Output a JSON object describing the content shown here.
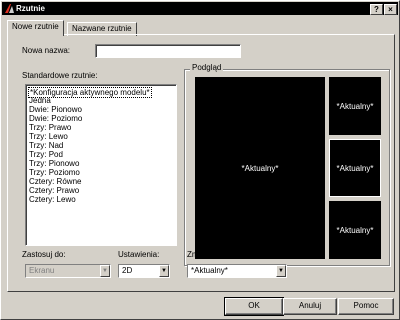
{
  "window": {
    "title": "Rzutnie",
    "help_label": "?",
    "close_label": "×"
  },
  "tabs": [
    {
      "label": "Nowe rzutnie",
      "active": true
    },
    {
      "label": "Nazwane rzutnie",
      "active": false
    }
  ],
  "new_name": {
    "label": "Nowa nazwa:",
    "value": ""
  },
  "standard_viewports": {
    "label": "Standardowe rzutnie:",
    "items": [
      "*Konfiguracja aktywnego modelu*",
      "Jedna",
      "Dwie:   Pionowo",
      "Dwie:   Poziomo",
      "Trzy:   Prawo",
      "Trzy:   Lewo",
      "Trzy:   Nad",
      "Trzy:   Pod",
      "Trzy:   Pionowo",
      "Trzy:   Poziomo",
      "Cztery: Równe",
      "Cztery: Prawo",
      "Cztery: Lewo"
    ],
    "selected_index": 0
  },
  "preview": {
    "label": "Podgląd",
    "main_label": "*Aktualny*",
    "side_labels": [
      "*Aktualny*",
      "*Aktualny*",
      "*Aktualny*"
    ],
    "active_side_index": 1
  },
  "apply_to": {
    "label": "Zastosuj do:",
    "value": "Ekranu",
    "enabled": false
  },
  "setup": {
    "label": "Ustawienia:",
    "value": "2D"
  },
  "change_view": {
    "label": "Zmień widok na:",
    "value": "*Aktualny*"
  },
  "buttons": {
    "ok": "OK",
    "cancel": "Anuluj",
    "help": "Pomoc"
  },
  "icons": {
    "app": "autocad-icon",
    "dropdown": "chevron-down-icon"
  }
}
